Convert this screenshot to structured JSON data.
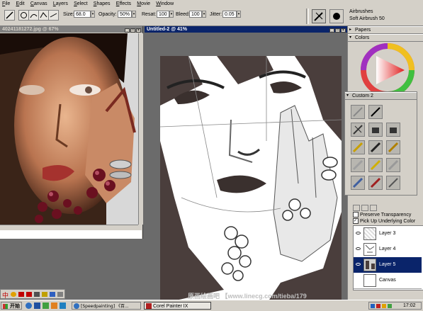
{
  "menu": {
    "items": [
      {
        "label": "File",
        "u": "F",
        "rest": "ile"
      },
      {
        "label": "Edit",
        "u": "E",
        "rest": "dit"
      },
      {
        "label": "Canvas",
        "u": "C",
        "rest": "anvas"
      },
      {
        "label": "Layers",
        "u": "L",
        "rest": "ayers"
      },
      {
        "label": "Select",
        "u": "S",
        "rest": "elect"
      },
      {
        "label": "Shapes",
        "u": "S",
        "rest": "hapes"
      },
      {
        "label": "Effects",
        "u": "E",
        "rest": "ffects"
      },
      {
        "label": "Movie",
        "u": "M",
        "rest": "ovie"
      },
      {
        "label": "Window",
        "u": "W",
        "rest": "indow"
      }
    ]
  },
  "propbar": {
    "size_label": "Size:",
    "size_value": "68.0",
    "opacity_label": "Opacity:",
    "opacity_value": "50%",
    "resat_label": "Resat:",
    "resat_value": "100",
    "bleed_label": "Bleed:",
    "bleed_value": "100",
    "jitter_label": "Jitter:",
    "jitter_value": "0.05",
    "brush_category": "Airbrushes",
    "brush_variant": "Soft Airbrush 50"
  },
  "windows": {
    "reference_title": "40241181272.jpg @ 67%",
    "canvas_title": "Untitled-2 @ 41%"
  },
  "palettes": {
    "papers_label": "Papers",
    "colors_label": "Colors",
    "custom_label": "Custom 2",
    "layers": {
      "preserve_label": "Preserve Transparency",
      "pickup_label": "Pick Up Underlying Color",
      "rows": [
        {
          "name": "Layer 3"
        },
        {
          "name": "Layer 4"
        },
        {
          "name": "Layer 5"
        },
        {
          "name": "Canvas"
        }
      ]
    }
  },
  "watermark": "原画绘画吧  【www.linecg.com/tieba/179",
  "taskbar": {
    "start_label": "开始",
    "tasks": [
      {
        "label": "[Speedpainting] 《百..."
      },
      {
        "label": "Corel Painter IX"
      }
    ],
    "clock": "17:02"
  },
  "ime": {
    "label": "中"
  },
  "colors": {
    "title_active": "#0a246a",
    "chrome": "#d4d0c8",
    "workspace": "#6b6b6b",
    "canvas_shadow": "#4a3e3c"
  }
}
